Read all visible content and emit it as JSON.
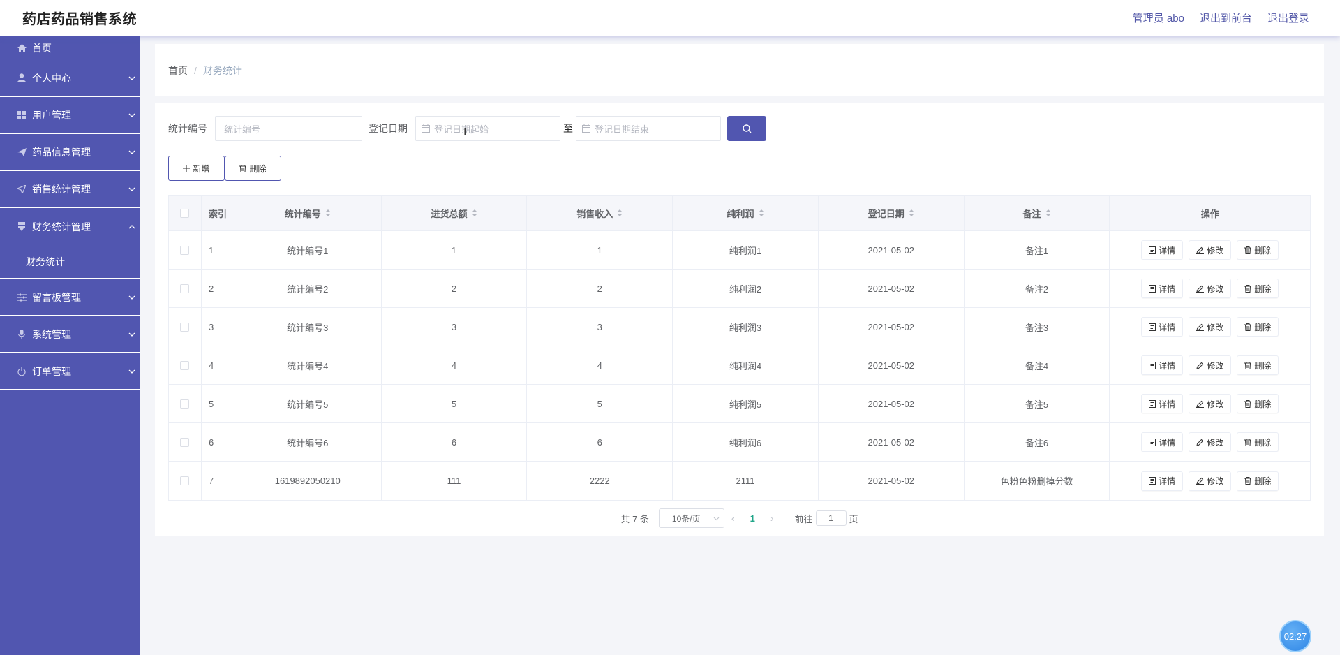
{
  "app": {
    "title": "药店药品销售系统",
    "user_label": "管理员 abo",
    "to_front": "退出到前台",
    "logout": "退出登录"
  },
  "sidebar": {
    "items": [
      {
        "label": "首页",
        "icon": "home-icon"
      },
      {
        "label": "个人中心",
        "icon": "user-icon"
      },
      {
        "label": "用户管理",
        "icon": "grid-icon"
      },
      {
        "label": "药品信息管理",
        "icon": "send-icon"
      },
      {
        "label": "销售统计管理",
        "icon": "navigate-icon"
      },
      {
        "label": "财务统计管理",
        "icon": "stack-icon"
      },
      {
        "label": "留言板管理",
        "icon": "sliders-icon"
      },
      {
        "label": "系统管理",
        "icon": "mic-icon"
      },
      {
        "label": "订单管理",
        "icon": "power-icon"
      }
    ],
    "submenu": "财务统计"
  },
  "breadcrumb": {
    "home": "首页",
    "sep": "/",
    "current": "财务统计"
  },
  "filter": {
    "code_label": "统计编号",
    "code_placeholder": "统计编号",
    "date_label": "登记日期",
    "date_start_placeholder": "登记日期起始",
    "to": "至",
    "date_end_placeholder": "登记日期结束"
  },
  "actions": {
    "add": "新增",
    "delete": "删除"
  },
  "table": {
    "headers": [
      "索引",
      "统计编号",
      "进货总额",
      "销售收入",
      "纯利润",
      "登记日期",
      "备注",
      "操作"
    ],
    "op_labels": {
      "detail": "详情",
      "edit": "修改",
      "delete": "删除"
    },
    "rows": [
      {
        "idx": "1",
        "code": "统计编号1",
        "purchase": "1",
        "sales": "1",
        "profit": "纯利润1",
        "date": "2021-05-02",
        "note": "备注1"
      },
      {
        "idx": "2",
        "code": "统计编号2",
        "purchase": "2",
        "sales": "2",
        "profit": "纯利润2",
        "date": "2021-05-02",
        "note": "备注2"
      },
      {
        "idx": "3",
        "code": "统计编号3",
        "purchase": "3",
        "sales": "3",
        "profit": "纯利润3",
        "date": "2021-05-02",
        "note": "备注3"
      },
      {
        "idx": "4",
        "code": "统计编号4",
        "purchase": "4",
        "sales": "4",
        "profit": "纯利润4",
        "date": "2021-05-02",
        "note": "备注4"
      },
      {
        "idx": "5",
        "code": "统计编号5",
        "purchase": "5",
        "sales": "5",
        "profit": "纯利润5",
        "date": "2021-05-02",
        "note": "备注5"
      },
      {
        "idx": "6",
        "code": "统计编号6",
        "purchase": "6",
        "sales": "6",
        "profit": "纯利润6",
        "date": "2021-05-02",
        "note": "备注6"
      },
      {
        "idx": "7",
        "code": "1619892050210",
        "purchase": "111",
        "sales": "2222",
        "profit": "2111",
        "date": "2021-05-02",
        "note": "色粉色粉删掉分数"
      }
    ]
  },
  "pagination": {
    "total": "共 7 条",
    "page_size": "10条/页",
    "current_page": "1",
    "goto_label": "前往",
    "goto_value": "1",
    "page_suffix": "页"
  },
  "timer": "02:27",
  "colors": {
    "accent": "#5156b0",
    "pager_active": "#21a689"
  }
}
